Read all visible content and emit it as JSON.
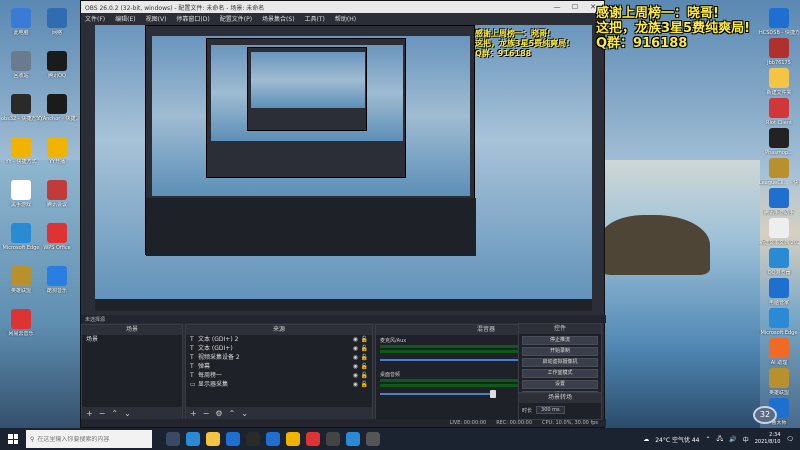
{
  "window": {
    "title": "OBS 26.0.2 (32-bit, windows) - 配置文件: 未命名 - 场景: 未命名",
    "menu": [
      "文件(F)",
      "编辑(E)",
      "视图(V)",
      "停靠窗口(D)",
      "配置文件(P)",
      "场景集合(S)",
      "工具(T)",
      "帮助(H)"
    ]
  },
  "docks": {
    "bar_label": "未选择源",
    "scenes": {
      "title": "场景",
      "items": [
        "场景"
      ]
    },
    "sources": {
      "title": "来源",
      "items": [
        {
          "icon": "text-icon",
          "label": "文本 (GDI+) 2"
        },
        {
          "icon": "text-icon",
          "label": "文本 (GDI+)"
        },
        {
          "icon": "text-icon",
          "label": "视频采集设备 2"
        },
        {
          "icon": "text-icon",
          "label": "弹幕"
        },
        {
          "icon": "text-icon",
          "label": "每周榜一"
        },
        {
          "icon": "monitor-icon",
          "label": "显示器采集"
        }
      ]
    },
    "mixer": {
      "title": "混音器",
      "channels": [
        {
          "name": "麦克风/Aux",
          "level_db": "0.0 dB"
        },
        {
          "name": "桌面音频",
          "level_db": "0.0 dB"
        }
      ]
    },
    "controls": {
      "title": "控件",
      "buttons": [
        "停止推流",
        "开始录制",
        "启动虚拟摄像机",
        "工作室模式",
        "设置",
        "退出"
      ]
    },
    "transitions": {
      "title": "场景转场",
      "duration_label": "时长",
      "duration_value": "300 ms"
    }
  },
  "statusbar": {
    "live": "LIVE: 00:00:00",
    "rec": "REC: 00:00:00",
    "cpu": "CPU: 10.0%, 30.00 fps"
  },
  "overlay": {
    "line1": "感谢上周榜一：晓哥!",
    "line2": "这把，龙族3星5费纯爽局!",
    "line3": "Q群：916188"
  },
  "desktop_icons_left": [
    {
      "label": "此电脑",
      "color": "#3a7bd5"
    },
    {
      "label": "网络",
      "color": "#2f6db0"
    },
    {
      "label": "回收站",
      "color": "#6a7b90"
    },
    {
      "label": "腾讯QQ",
      "color": "#1b1b1b"
    },
    {
      "label": "obs32 - 快捷方式",
      "color": "#2a2a2a"
    },
    {
      "label": "YYAnchor - 快捷方式",
      "color": "#1b1b1b"
    },
    {
      "label": "YY - 快捷方式",
      "color": "#f0b400"
    },
    {
      "label": "YY开播",
      "color": "#f0b400"
    },
    {
      "label": "黑手游戏",
      "color": "#ffffff"
    },
    {
      "label": "腾讯会议",
      "color": "#c23b3b"
    },
    {
      "label": "Microsoft Edge",
      "color": "#2a8ad4"
    },
    {
      "label": "WPS Office",
      "color": "#d33"
    },
    {
      "label": "英雄联盟",
      "color": "#b8902d"
    },
    {
      "label": "酷狗音乐",
      "color": "#2a7de1"
    },
    {
      "label": "网易云音乐",
      "color": "#d33"
    }
  ],
  "desktop_icons_right": [
    {
      "label": "HCSDSB - 快捷方式",
      "color": "#1e6fd0"
    },
    {
      "label": "Jbb76175",
      "color": "#b0302c"
    },
    {
      "label": "新建文件夹",
      "color": "#f4c542"
    },
    {
      "label": "Riot Client",
      "color": "#d13639"
    },
    {
      "label": "Phasmop...",
      "color": "#222"
    },
    {
      "label": "LeagueCli... - 快捷方式",
      "color": "#b8902d"
    },
    {
      "label": "腾讯手游助手",
      "color": "#1e6fd0"
    },
    {
      "label": "新建文本文档 2021010...",
      "color": "#eee"
    },
    {
      "label": "QQ浏览器",
      "color": "#2a8ad4"
    },
    {
      "label": "电脑管家",
      "color": "#1e6fd0"
    },
    {
      "label": "Microsoft Edge",
      "color": "#2a8ad4"
    },
    {
      "label": "AI 助理",
      "color": "#f06a26"
    },
    {
      "label": "英雄联盟",
      "color": "#b8902d"
    },
    {
      "label": "鲁大师",
      "color": "#1e6fd0"
    }
  ],
  "taskbar": {
    "search_placeholder": "在这里输入你要搜索的内容",
    "weather": "24°C 空气优 44",
    "time": "2:34",
    "date": "2021/8/10",
    "badge": "32",
    "lang": "中"
  }
}
